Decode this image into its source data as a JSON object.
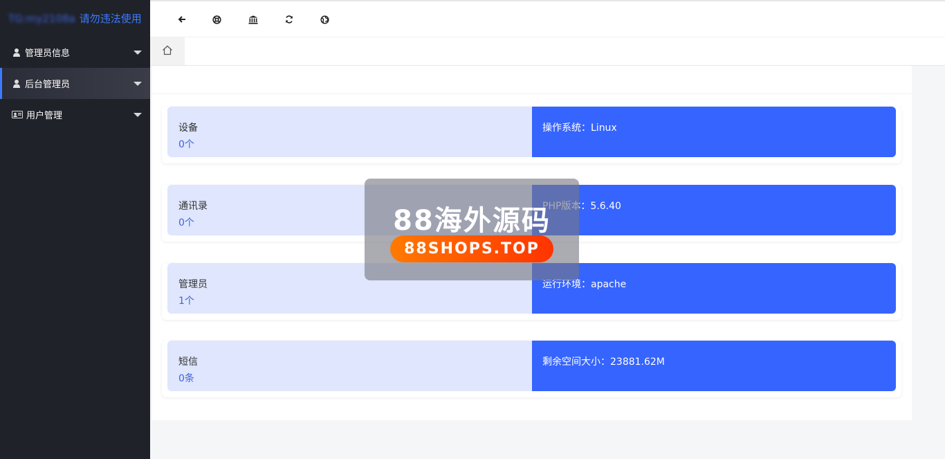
{
  "brand": {
    "blurred_name": "TG:my2108a",
    "tagline": "请勿违法使用"
  },
  "sidebar": {
    "items": [
      {
        "label": "管理员信息",
        "icon": "user-icon",
        "active": false
      },
      {
        "label": "后台管理员",
        "icon": "user-icon",
        "active": true
      },
      {
        "label": "用户管理",
        "icon": "id-card-icon",
        "active": false
      }
    ]
  },
  "toolbar": {
    "icons": [
      "arrow-left-icon",
      "lifebuoy-icon",
      "bank-icon",
      "refresh-icon",
      "globe-icon"
    ]
  },
  "tabs": {
    "home_icon": "home-icon"
  },
  "stats": [
    {
      "label": "设备",
      "value": "0个",
      "info": "操作系统：Linux"
    },
    {
      "label": "通讯录",
      "value": "0个",
      "info": "PHP版本：5.6.40"
    },
    {
      "label": "管理员",
      "value": "1个",
      "info": "运行环境：apache"
    },
    {
      "label": "短信",
      "value": "0条",
      "info": "剩余空间大小：23881.62M"
    }
  ],
  "watermark": {
    "title": "88海外源码",
    "url": "88SHOPS.TOP"
  },
  "colors": {
    "sidebar_bg": "#20222a",
    "accent": "#3664ff",
    "card_left_bg": "#dfe6fd",
    "value_text": "#3f64d6"
  }
}
